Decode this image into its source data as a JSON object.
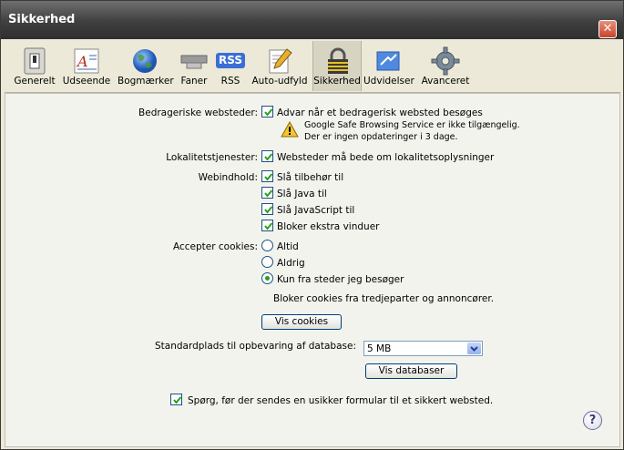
{
  "window": {
    "title": "Sikkerhed",
    "close_glyph": "✕"
  },
  "toolbar": {
    "items": [
      {
        "label": "Generelt",
        "icon": "switch-icon"
      },
      {
        "label": "Udseende",
        "icon": "font-icon"
      },
      {
        "label": "Bogmærker",
        "icon": "globe-icon"
      },
      {
        "label": "Faner",
        "icon": "tabs-icon"
      },
      {
        "label": "RSS",
        "icon": "rss-icon"
      },
      {
        "label": "Auto-udfyld",
        "icon": "pencil-icon"
      },
      {
        "label": "Sikkerhed",
        "icon": "lock-icon",
        "selected": true
      },
      {
        "label": "Udvidelser",
        "icon": "puzzle-icon"
      },
      {
        "label": "Avanceret",
        "icon": "gear-icon"
      }
    ],
    "rss_text": "RSS"
  },
  "fraud": {
    "label": "Bedrageriske websteder:",
    "checkbox_label": "Advar når et bedragerisk websted besøges",
    "checked": true,
    "warning_line1": "Google Safe Browsing Service er ikke tilgængelig.",
    "warning_line2": "Der er ingen opdateringer i 3 dage."
  },
  "location": {
    "label": "Lokalitetstjenester:",
    "checkbox_label": "Websteder må bede om lokalitetsoplysninger",
    "checked": true
  },
  "webcontent": {
    "label": "Webindhold:",
    "items": [
      {
        "label": "Slå tilbehør til",
        "checked": true
      },
      {
        "label": "Slå Java til",
        "checked": true
      },
      {
        "label": "Slå JavaScript til",
        "checked": true
      },
      {
        "label": "Bloker ekstra vinduer",
        "checked": true
      }
    ]
  },
  "cookies": {
    "label": "Accepter cookies:",
    "options": [
      {
        "label": "Altid",
        "selected": false
      },
      {
        "label": "Aldrig",
        "selected": false
      },
      {
        "label": "Kun fra steder jeg besøger",
        "selected": true
      }
    ],
    "note": "Bloker cookies fra tredjeparter og annoncører.",
    "show_button": "Vis cookies"
  },
  "database": {
    "label": "Standardplads til opbevaring af database:",
    "selected": "5 MB",
    "show_button": "Vis databaser"
  },
  "form_warning": {
    "checkbox_label": "Spørg, før der sendes en usikker formular til et sikkert websted.",
    "checked": true
  },
  "help": {
    "glyph": "?"
  }
}
